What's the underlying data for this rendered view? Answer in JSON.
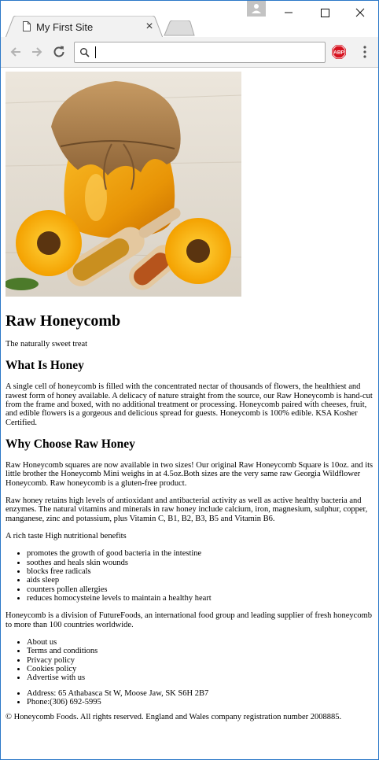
{
  "browser": {
    "tab_title": "My First Site",
    "tab_close": "×",
    "address_value": "",
    "abp_label": "ABP",
    "colors": {
      "frame_border": "#2b78c8",
      "abp_red": "#d6121f",
      "toolbar": "#f2f2f2"
    }
  },
  "page": {
    "hero_image_alt": "honey jar with burlap cover, sunflowers and bee pollen scoops",
    "title": "Raw Honeycomb",
    "tagline": "The naturally sweet treat",
    "what_heading": "What Is Honey",
    "what_text": "A single cell of honeycomb is filled with the concentrated nectar of thousands of flowers, the healthiest and rawest form of honey available. A delicacy of nature straight from the source, our Raw Honeycomb is hand-cut from the frame and boxed, with no additional treatment or processing. Honeycomb paired with cheeses, fruit, and edible flowers is a gorgeous and delicious spread for guests. Honeycomb is 100% edible. KSA Kosher Certified.",
    "why_heading": "Why Choose Raw Honey",
    "why_text_1": "Raw Honeycomb squares are now available in two sizes! Our original Raw Honeycomb Square is 10oz. and its little brother the Honeycomb Mini weighs in at 4.5oz.Both sizes are the very same raw Georgia Wildflower Honeycomb. Raw honeycomb is a gluten-free product.",
    "why_text_2": "Raw honey retains high levels of antioxidant and antibacterial activity as well as active healthy bacteria and enzymes. The natural vitamins and minerals in raw honey include calcium, iron, magnesium, sulphur, copper, manganese, zinc and potassium, plus Vitamin C, B1, B2, B3, B5 and Vitamin B6.",
    "benefits_intro": "A rich taste High nutritional benefits",
    "benefits": [
      "promotes the growth of good bacteria in the intestine",
      "soothes and heals skin wounds",
      "blocks free radicals",
      "aids sleep",
      "counters pollen allergies",
      "reduces homocysteine levels to maintain a healthy heart"
    ],
    "company_text": "Honeycomb is a division of FutureFoods, an international food group and leading supplier of fresh honeycomb to more than 100 countries worldwide.",
    "footer_links": [
      "About us",
      "Terms and conditions",
      "Privacy policy",
      "Cookies policy",
      "Advertise with us"
    ],
    "contact": [
      "Address: 65 Athabasca St W, Moose Jaw, SK S6H 2B7",
      "Phone:(306) 692-5995"
    ],
    "copyright": "© Honeycomb Foods. All rights reserved. England and Wales company registration number 2008885."
  }
}
